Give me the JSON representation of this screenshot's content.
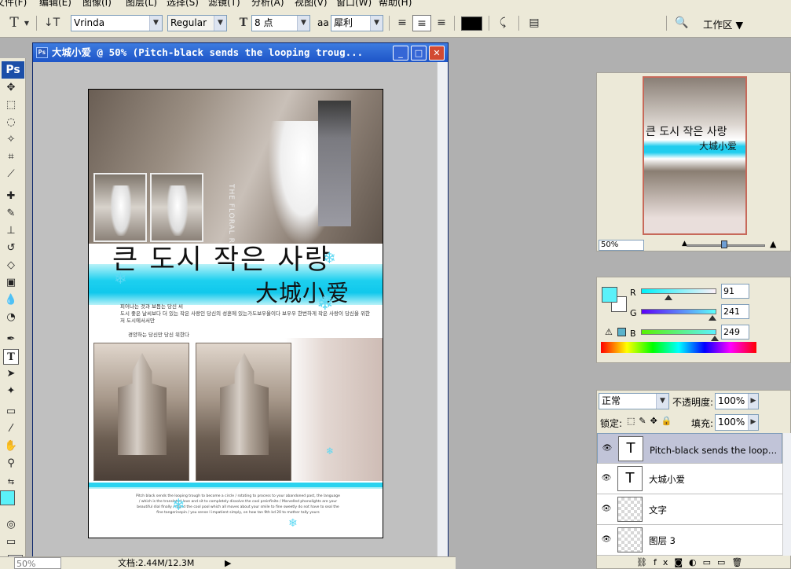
{
  "menu": [
    "文件(F)",
    "编辑(E)",
    "图像(I)",
    "图层(L)",
    "选择(S)",
    "滤镜(T)",
    "分析(A)",
    "视图(V)",
    "窗口(W)",
    "帮助(H)"
  ],
  "options": {
    "tool_glyph": "T",
    "font_family": "Vrinda",
    "font_style": "Regular",
    "font_size": "8 点",
    "aa_label": "a",
    "aa_mode": "犀利",
    "workspace": "工作区"
  },
  "tools": [
    "move-icon",
    "marquee-icon",
    "lasso-icon",
    "magic-wand-icon",
    "crop-icon",
    "slice-icon",
    "healing-icon",
    "brush-icon",
    "stamp-icon",
    "history-brush-icon",
    "eraser-icon",
    "gradient-icon",
    "blur-icon",
    "dodge-icon",
    "pen-icon",
    "type-icon",
    "path-select-icon",
    "shape-icon",
    "notes-icon",
    "eyedropper-icon",
    "hand-icon",
    "zoom-icon"
  ],
  "colors": {
    "foreground": "#5bf1f9",
    "background": "#ffffff",
    "accent": "#1d55c8"
  },
  "document": {
    "title": "大城小爱 @ 50% (Pitch-black sends the looping troug...",
    "korean_title": "큰 도시 작은 사랑",
    "chinese_title": "大城小爱",
    "body_line1": "피어나는 것과 보듬는 당신 씨",
    "body_line2": "도시 좋은 날씨보다 더 있는 작은 사랑인 당신의 성혼에 있는가도보우울이다 보우우 한번하게 작은 사랑이 당신을 위한 저 도시에서서만",
    "body_line3": "경양하는 당신만 당신 위한다",
    "footer_text": "Pitch black sends the looping trough to become a circle / rotating to process to your abandoned past, the language / which is the translated love and sit to completely dissolve the cool preinfinite / Marvelled phonolights are your beautiful dial finally / found the cool pool which all moves about your smile to fine sweetly do not have to seal the fine tangerinepin / you sense I impatient simply, on how tan 9th kd 20 to mother tally yours",
    "vertical_text": "THE FLORAL ROMANCE"
  },
  "status": {
    "zoom": "50%",
    "doc_size": "文档:2.44M/12.3M"
  },
  "navigator": {
    "zoom": "50%"
  },
  "color_panel": {
    "r_label": "R",
    "r_value": "91",
    "r_fraction": 0.36,
    "g_label": "G",
    "g_value": "241",
    "g_fraction": 0.95,
    "b_label": "B",
    "b_value": "249",
    "b_fraction": 0.98
  },
  "layers_panel": {
    "blend_mode": "正常",
    "opacity_label": "不透明度:",
    "opacity": "100%",
    "lock_label": "锁定:",
    "fill_label": "填充:",
    "fill": "100%",
    "layers": [
      {
        "name": "Pitch-black sends the looping t...",
        "type": "text"
      },
      {
        "name": "大城小爱",
        "type": "text"
      },
      {
        "name": "文字",
        "type": "image"
      },
      {
        "name": "图层 3",
        "type": "image"
      }
    ]
  }
}
